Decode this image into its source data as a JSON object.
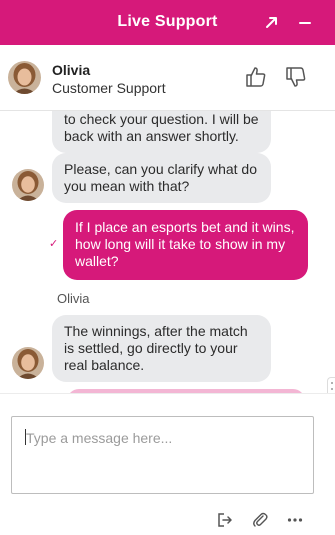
{
  "header": {
    "title": "Live Support",
    "background": "#d6197a"
  },
  "agent": {
    "name": "Olivia",
    "role": "Customer Support"
  },
  "messages": [
    {
      "from": "agent",
      "text": "to check your question. I will be back with an answer shortly."
    },
    {
      "from": "agent",
      "text": "Please, can you clarify what do you mean with that?"
    },
    {
      "from": "user",
      "text": "If I place an esports bet and it wins, how long will it take to show in my wallet?"
    },
    {
      "from": "agent",
      "sender": "Olivia",
      "text": "The winnings, after the match is settled, go directly to your real balance."
    }
  ],
  "composer": {
    "placeholder": "Type a message here..."
  },
  "colors": {
    "accent": "#d6197a",
    "agent_bubble": "#e9eaec"
  },
  "icons": [
    "expand-icon",
    "minimize-icon",
    "thumbs-up-icon",
    "thumbs-down-icon",
    "end-chat-icon",
    "attach-icon",
    "more-icon"
  ]
}
